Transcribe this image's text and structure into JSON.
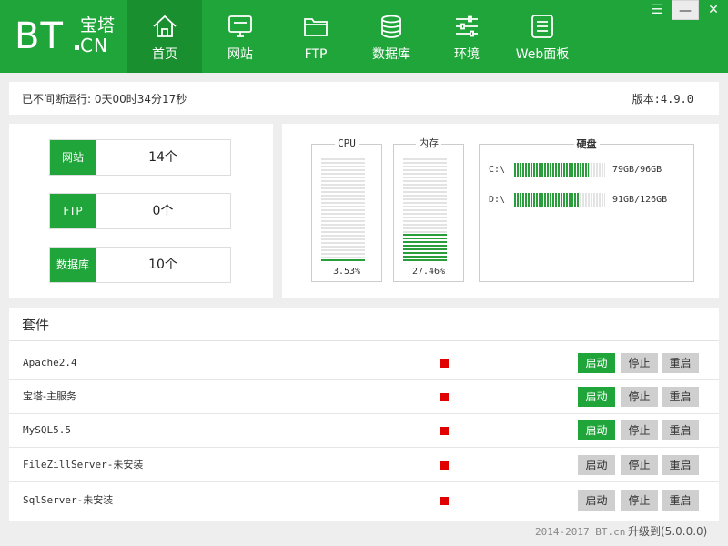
{
  "logo": {
    "text_bt": "BT",
    "text_zh": "宝塔",
    "text_cn": "CN"
  },
  "nav": {
    "items": [
      {
        "label": "首页",
        "icon": "home-icon",
        "active": true
      },
      {
        "label": "网站",
        "icon": "monitor-icon",
        "active": false
      },
      {
        "label": "FTP",
        "icon": "folder-icon",
        "active": false
      },
      {
        "label": "数据库",
        "icon": "database-icon",
        "active": false
      },
      {
        "label": "环境",
        "icon": "sliders-icon",
        "active": false
      },
      {
        "label": "Web面板",
        "icon": "list-icon",
        "active": false
      }
    ]
  },
  "window": {
    "menu": "☰",
    "minimize": "—",
    "close": "✕"
  },
  "status": {
    "uptime": "已不间断运行: 0天00时34分17秒",
    "version": "版本:4.9.0"
  },
  "stats": [
    {
      "label": "网站",
      "value": "14个"
    },
    {
      "label": "FTP",
      "value": "0个"
    },
    {
      "label": "数据库",
      "value": "10个"
    }
  ],
  "resources": {
    "cpu": {
      "label": "CPU",
      "percent_text": "3.53%",
      "percent": 3.53
    },
    "memory": {
      "label": "内存",
      "percent_text": "27.46%",
      "percent": 27.46
    },
    "disk": {
      "title": "硬盘",
      "drives": [
        {
          "drive": "C:\\",
          "size_text": "79GB/96GB",
          "used": 79,
          "total": 96
        },
        {
          "drive": "D:\\",
          "size_text": "91GB/126GB",
          "used": 91,
          "total": 126
        }
      ]
    }
  },
  "services": {
    "title": "套件",
    "items": [
      {
        "name": "Apache2.4",
        "start": "启动",
        "stop": "停止",
        "restart": "重启",
        "start_enabled": true
      },
      {
        "name": "宝塔-主服务",
        "start": "启动",
        "stop": "停止",
        "restart": "重启",
        "start_enabled": true
      },
      {
        "name": "MySQL5.5",
        "start": "启动",
        "stop": "停止",
        "restart": "重启",
        "start_enabled": true
      },
      {
        "name": "FileZillServer-未安装",
        "start": "启动",
        "stop": "停止",
        "restart": "重启",
        "start_enabled": false
      },
      {
        "name": "SqlServer-未安装",
        "start": "启动",
        "stop": "停止",
        "restart": "重启",
        "start_enabled": false
      }
    ]
  },
  "footer": {
    "copyright": "2014-2017 BT.cn",
    "upgrade": "升级到(5.0.0.0)"
  },
  "colors": {
    "brand": "#20a53a",
    "brand_dark": "#1a8f30",
    "status_stopped": "#e00000"
  }
}
